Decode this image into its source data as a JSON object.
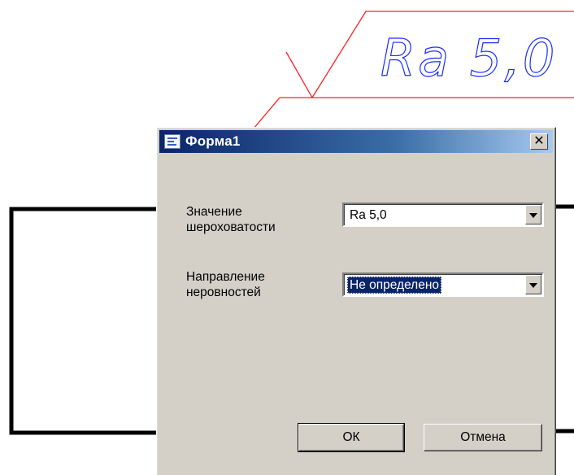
{
  "background": {
    "annotation_text": "Ra 5,0",
    "annotation_color": "#1a2cff",
    "leader_color": "#ff2020",
    "outline_color": "#000000"
  },
  "dialog": {
    "title": "Форма1",
    "icon": "form-window-icon",
    "close_glyph": "✕",
    "title_gradient_start": "#0a246a",
    "title_gradient_end": "#a6caf0",
    "fields": [
      {
        "label_line1": "Значение",
        "label_line2": "шероховатости",
        "value": "Ra 5,0"
      },
      {
        "label_line1": "Направление",
        "label_line2": "неровностей",
        "value": "Не определено"
      }
    ],
    "ok_label": "ОК",
    "cancel_label": "Отмена"
  }
}
